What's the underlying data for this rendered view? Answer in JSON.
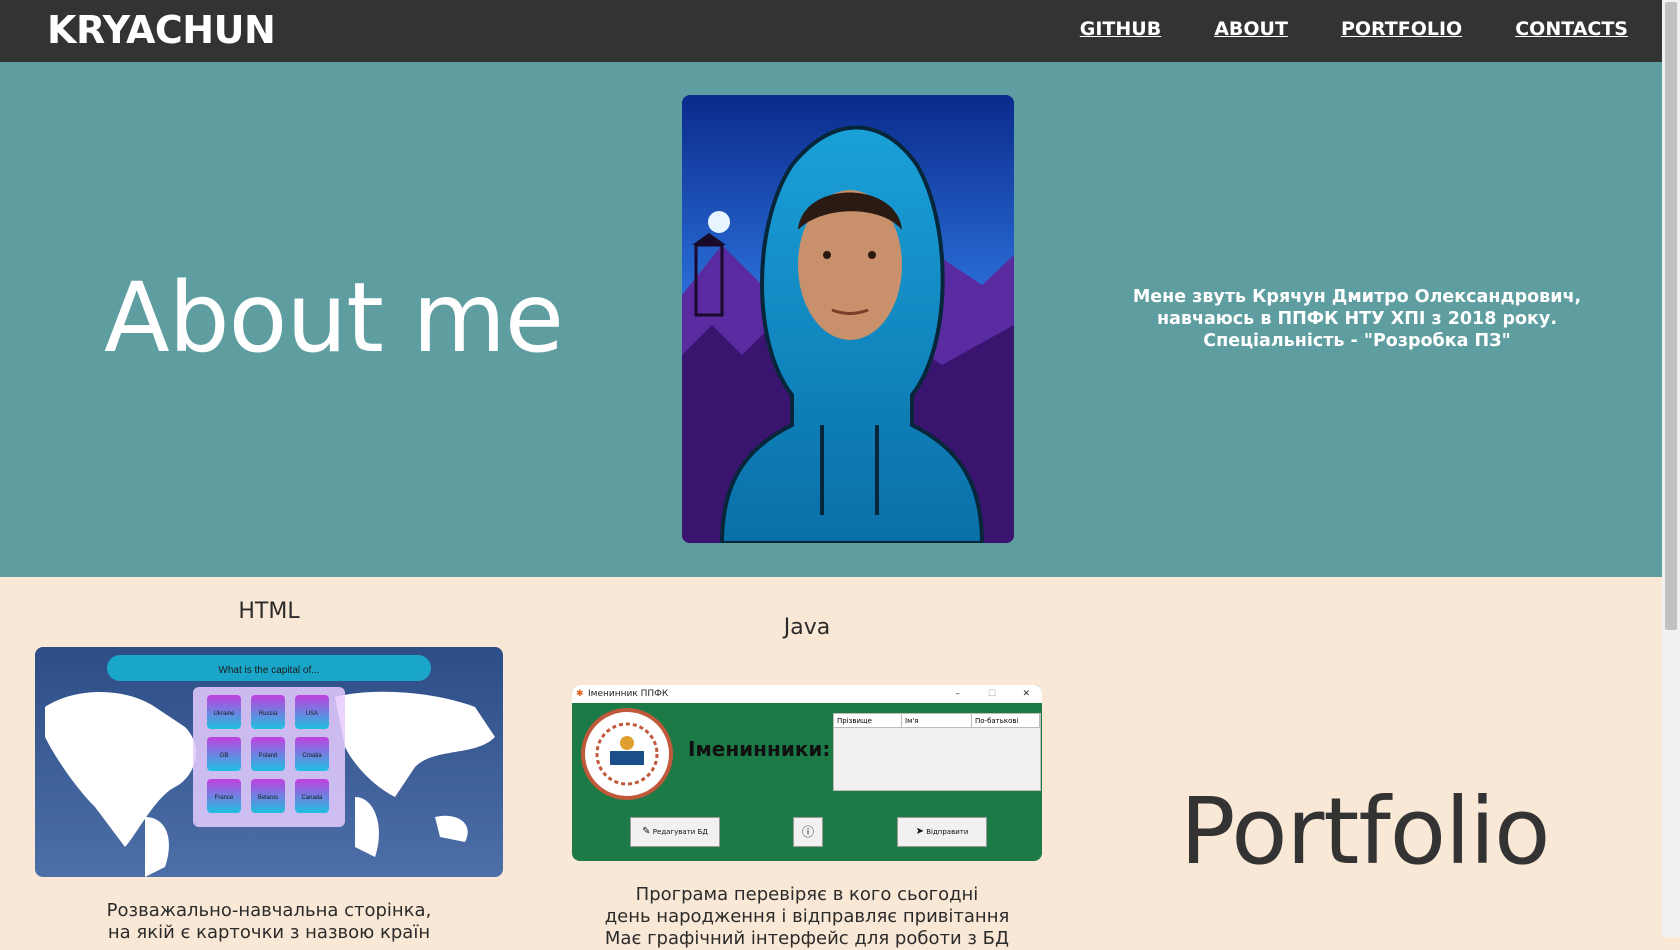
{
  "header": {
    "brand": "KRYACHUN",
    "nav": [
      "GITHUB",
      "ABOUT",
      "PORTFOLIO",
      "CONTACTS"
    ]
  },
  "about": {
    "title": "About me",
    "text_lines": [
      "Мене звуть Крячун Дмитро Олександрович,",
      "навчаюсь в ППФК НТУ ХПІ з 2018 року.",
      "Спеціальність - \"Розробка ПЗ\""
    ]
  },
  "portfolio": {
    "title": "Portfolio",
    "cards": [
      {
        "title": "HTML",
        "quiz_question": "What is the capital of...",
        "quiz_options": [
          "Ukraine",
          "Russia",
          "USA",
          "GB",
          "Poland",
          "Croatia",
          "France",
          "Belarus",
          "Canada"
        ],
        "desc_lines": [
          "Розважально-навчальна сторінка,",
          "на якій є карточки з назвою країн"
        ]
      },
      {
        "title": "Java",
        "app_title": "Іменинник ППФК",
        "app_heading": "Іменинники:",
        "table_headers": [
          "Прізвище",
          "Ім'я",
          "По-батькові"
        ],
        "buttons": [
          "Редагувати БД",
          "ⓘ",
          "Відправити"
        ],
        "desc_lines": [
          "Програма перевіряє в кого сьогодні",
          "день народження і відправляє привітання",
          "Має графічний інтерфейс для роботи з БД"
        ]
      }
    ]
  },
  "colors": {
    "header_bg": "#333333",
    "about_bg": "#5f9ea0",
    "portfolio_bg": "#f9e8d6"
  }
}
